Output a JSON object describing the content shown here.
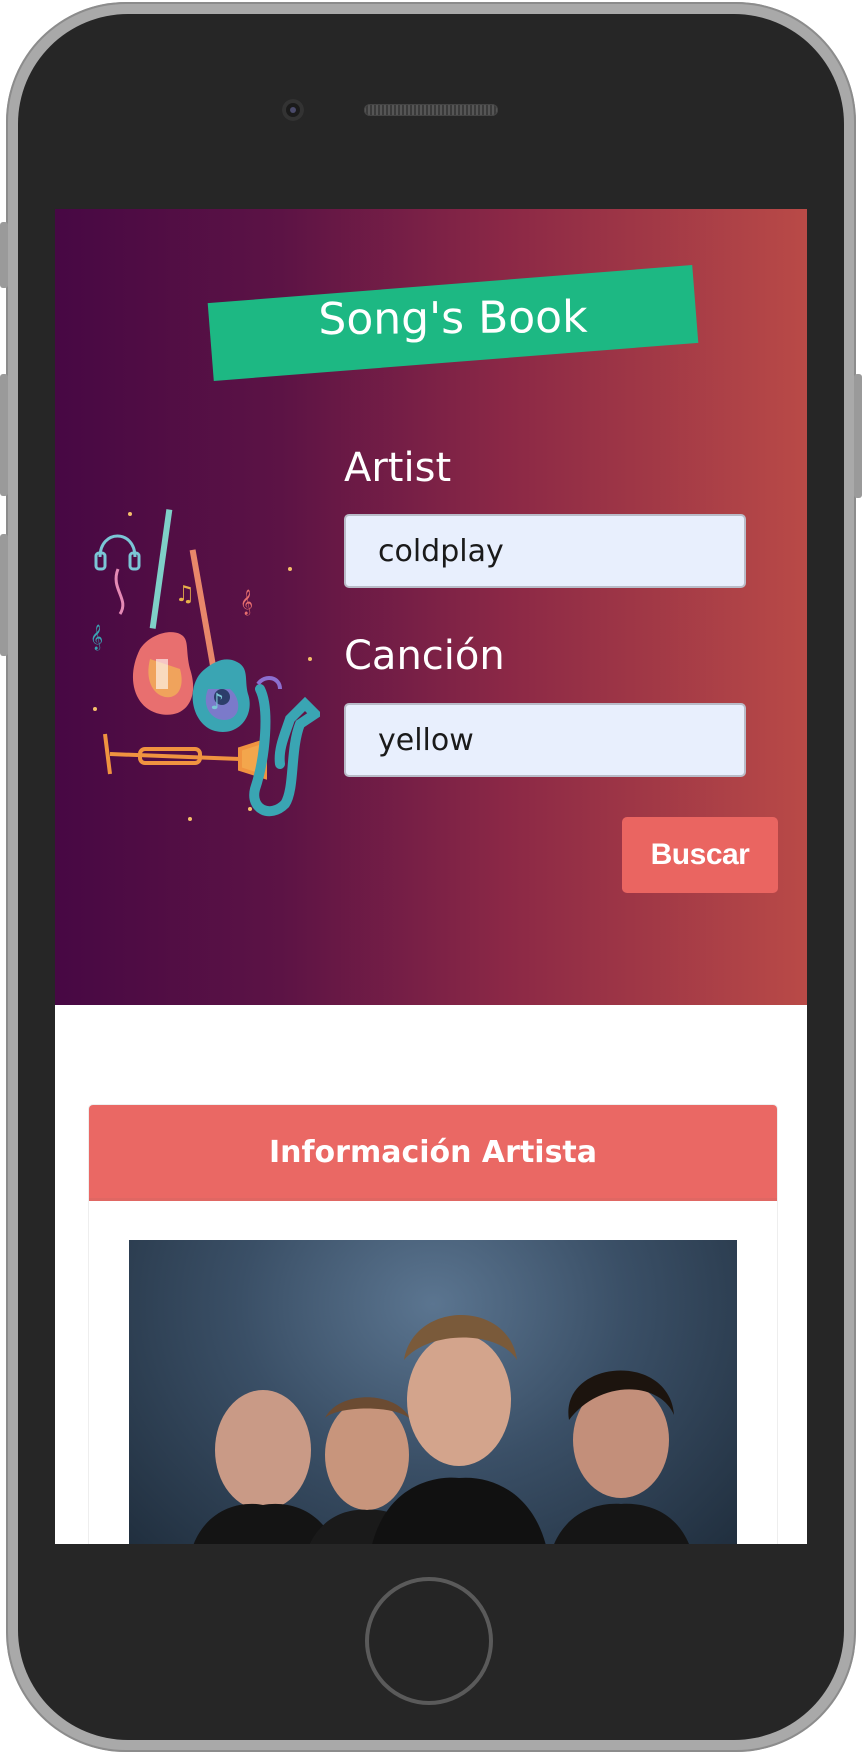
{
  "app": {
    "title": "Song's Book"
  },
  "form": {
    "artist_label": "Artist",
    "artist_value": "coldplay",
    "song_label": "Canción",
    "song_value": "yellow",
    "search_button": "Buscar"
  },
  "artist_card": {
    "header": "Información Artista",
    "photo_subject": "band photo"
  },
  "colors": {
    "hero_gradient_start": "#470844",
    "hero_gradient_end": "#b94a47",
    "title_banner": "#1db883",
    "accent": "#ea6561",
    "input_bg": "#e8effd"
  },
  "icons": {
    "hero_illustration": "musical-instruments-illustration"
  }
}
